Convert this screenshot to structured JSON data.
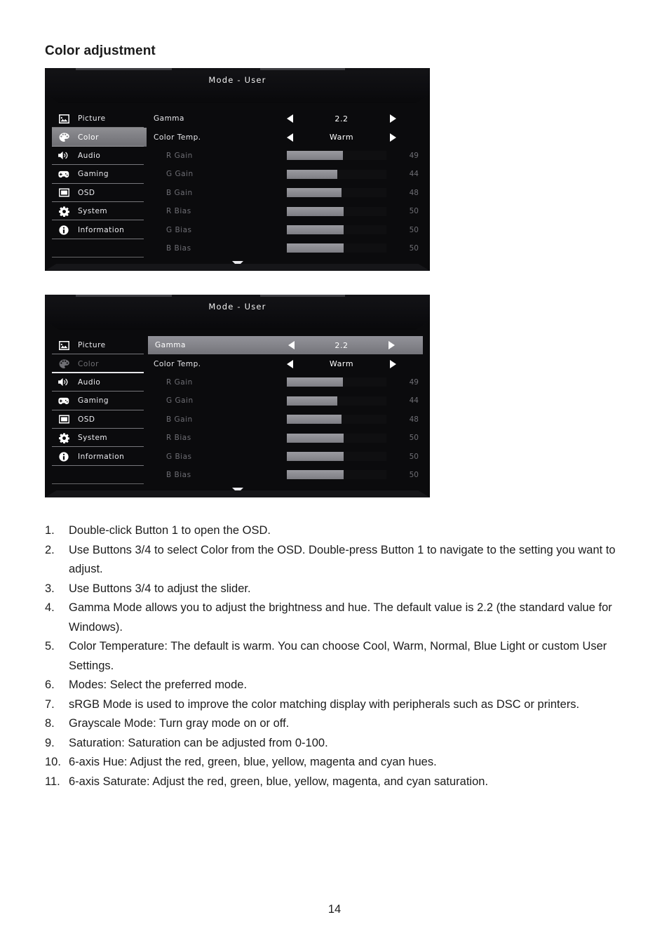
{
  "page": {
    "heading": "Color adjustment",
    "number": "14"
  },
  "osd": {
    "title": "Mode  -  User",
    "sidebar": [
      {
        "icon": "picture-icon",
        "label": "Picture"
      },
      {
        "icon": "palette-icon",
        "label": "Color"
      },
      {
        "icon": "speaker-icon",
        "label": "Audio"
      },
      {
        "icon": "gamepad-icon",
        "label": "Gaming"
      },
      {
        "icon": "monitor-icon",
        "label": "OSD"
      },
      {
        "icon": "gear-icon",
        "label": "System"
      },
      {
        "icon": "information-icon",
        "label": "Information"
      }
    ],
    "settings": [
      {
        "name": "Gamma",
        "type": "select",
        "value": "2.2"
      },
      {
        "name": "Color  Temp.",
        "type": "select",
        "value": "Warm"
      },
      {
        "name": "R  Gain",
        "type": "slider",
        "value": "49",
        "percent": 49
      },
      {
        "name": "G  Gain",
        "type": "slider",
        "value": "44",
        "percent": 44
      },
      {
        "name": "B  Gain",
        "type": "slider",
        "value": "48",
        "percent": 48
      },
      {
        "name": "R  Bias",
        "type": "slider",
        "value": "50",
        "percent": 50
      },
      {
        "name": "G  Bias",
        "type": "slider",
        "value": "50",
        "percent": 50
      },
      {
        "name": "B  Bias",
        "type": "slider",
        "value": "50",
        "percent": 50
      }
    ],
    "scroll_indicator": "chevron-down",
    "panel_1": {
      "selected_sidebar_index": 1,
      "highlighted_setting_index": -1
    },
    "panel_2": {
      "selected_sidebar_index": -1,
      "dimmed_sidebar_index": 1,
      "highlighted_setting_index": 0
    }
  },
  "steps": [
    {
      "num": "1.",
      "text": "Double-click Button 1 to open the OSD."
    },
    {
      "num": "2.",
      "text": "Use Buttons 3/4 to select Color from the OSD. Double-press Button 1 to navigate to the setting you want to adjust."
    },
    {
      "num": "3.",
      "text": "Use Buttons 3/4 to adjust the slider."
    },
    {
      "num": "4.",
      "text": "Gamma Mode allows you to adjust the brightness and hue. The default value is 2.2 (the standard value for Windows)."
    },
    {
      "num": "5.",
      "text": "Color Temperature: The default is warm. You can choose Cool, Warm, Normal, Blue Light or custom User Settings."
    },
    {
      "num": "6.",
      "text": "Modes: Select the preferred mode."
    },
    {
      "num": "7.",
      "text": "sRGB Mode is used to improve the color matching display with peripherals such as DSC or printers."
    },
    {
      "num": "8.",
      "text": "Grayscale Mode: Turn gray mode on or off."
    },
    {
      "num": "9.",
      "text": "Saturation: Saturation can be adjusted from 0-100."
    },
    {
      "num": "10.",
      "text": "6-axis Hue: Adjust the red, green, blue, yellow, magenta and cyan hues."
    },
    {
      "num": "11.",
      "text": "6-axis Saturate: Adjust the red, green, blue, yellow, magenta, and cyan saturation."
    }
  ],
  "colors": {
    "osd_background": "#0b0b0d",
    "osd_header": "#151518",
    "highlight": "#84848a",
    "slider_fill": "#8b8b91",
    "text_primary": "#eaeaee",
    "text_dim": "#6e6e74"
  }
}
